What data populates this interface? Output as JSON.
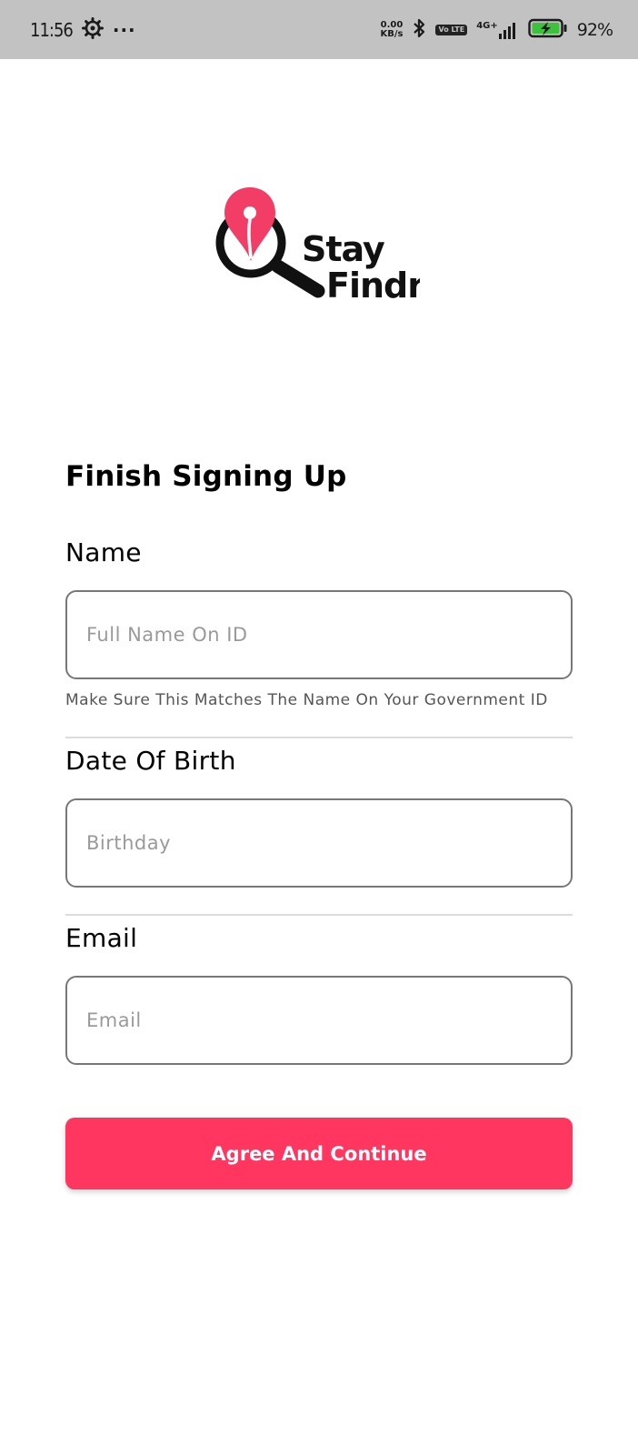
{
  "status_bar": {
    "time": "11:56",
    "more": "···",
    "speed_value": "0.00",
    "speed_unit": "KB/s",
    "volte": "Vo LTE",
    "network": "4G+",
    "battery": "92%",
    "icons": [
      "settings-icon",
      "bluetooth-icon",
      "signal-icon",
      "battery-charging-icon"
    ]
  },
  "logo": {
    "line1": "Stay",
    "line2": "Findr",
    "colors": {
      "pin": "#f23d66",
      "lens": "#111111"
    }
  },
  "form": {
    "title": "Finish Signing Up",
    "name": {
      "label": "Name",
      "placeholder": "Full Name On ID",
      "helper": "Make Sure This Matches The Name On Your Government ID"
    },
    "dob": {
      "label": "Date Of Birth",
      "placeholder": "Birthday"
    },
    "email": {
      "label": "Email",
      "placeholder": "Email"
    },
    "submit_label": "Agree And Continue"
  },
  "colors": {
    "accent": "#ff3660",
    "status_bar_bg": "#c2c2c2",
    "input_border": "#777777",
    "placeholder": "#9a9a9a"
  }
}
